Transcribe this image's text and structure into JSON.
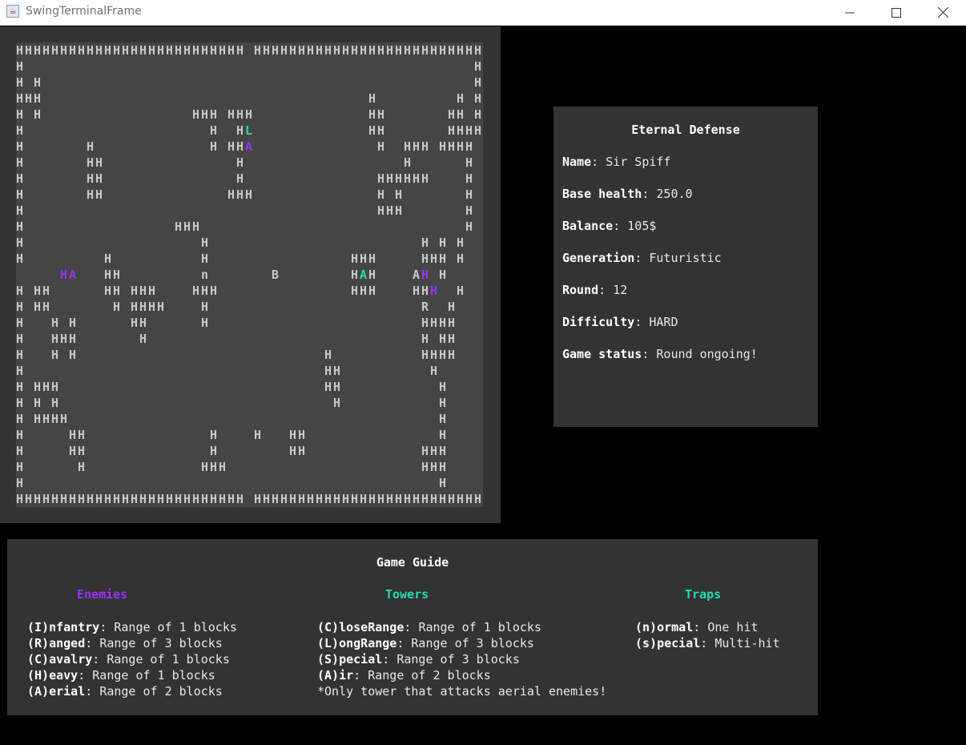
{
  "window": {
    "title": "SwingTerminalFrame"
  },
  "colors": {
    "wall": "#c8c8c8",
    "enemy": "#9b30ff",
    "tower": "#22ddb0",
    "panel": "#333333",
    "grid": "#454545",
    "background": "#000000"
  },
  "map": {
    "rows": [
      "HHHHHHHHHHHHHHHHHHHHHHHHHH HHHHHHHHHHHHHHHHHHHHHHHHHH",
      "H                                                   H",
      "H H                                                 H",
      "HHH                                     H         H H",
      "H H                 HHH HHH             HH       HH H",
      "H                     H  HL             HH       HHHH",
      "H       H             H HHA              H  HHH HHHH",
      "H       HH               H                  H      H",
      "H       HH               H               HHHHHH    H",
      "H       HH              HHH              H H       H",
      "H                                        HHH       H",
      "H                 HHH                              H",
      "H                    H                        H H H",
      "H         H          H                HHH     HHH H",
      "     HA   HH         n       B        HAH    AH H",
      "H HH      HH HHH    HHH               HHH    HHH  H",
      "H HH       H HHHH    H                        R  H",
      "H   H H      HH      H                        HHHH",
      "H   HHH       H                               H HH",
      "H   H H                            H          HHHH",
      "H                                  HH          H",
      "H HHH                              HH           H",
      "H H H                               H           H",
      "H HHHH                                          H",
      "H     HH              H    H   HH               H",
      "H     HH              H        HH             HHH",
      "H      H             HHH                      HHH",
      "H                                               H",
      "HHHHHHHHHHHHHHHHHHHHHHHHHH HHHHHHHHHHHHHHHHHHHHHHHHHH"
    ],
    "colored_cells": [
      {
        "row": 5,
        "col": 26,
        "kind": "tower"
      },
      {
        "row": 6,
        "col": 26,
        "kind": "enemy"
      },
      {
        "row": 14,
        "col": 5,
        "kind": "enemy"
      },
      {
        "row": 14,
        "col": 6,
        "kind": "enemy"
      },
      {
        "row": 14,
        "col": 19,
        "kind": "trap"
      },
      {
        "row": 14,
        "col": 26,
        "kind": "tower"
      },
      {
        "row": 14,
        "col": 39,
        "kind": "tower"
      },
      {
        "row": 14,
        "col": 46,
        "kind": "enemy"
      },
      {
        "row": 15,
        "col": 47,
        "kind": "enemy"
      },
      {
        "row": 16,
        "col": 47,
        "kind": "enemy"
      },
      {
        "row": 24,
        "col": 26,
        "kind": "enemy"
      }
    ]
  },
  "status": {
    "title": "Eternal Defense",
    "fields": [
      {
        "label": "Name",
        "value": "Sir Spiff"
      },
      {
        "label": "Base health",
        "value": "250.0"
      },
      {
        "label": "Balance",
        "value": "105$"
      },
      {
        "label": "Generation",
        "value": "Futuristic"
      },
      {
        "label": "Round",
        "value": "12"
      },
      {
        "label": "Difficulty",
        "value": "HARD"
      },
      {
        "label": "Game status",
        "value": "Round ongoing!"
      }
    ]
  },
  "guide": {
    "title": "Game Guide",
    "enemies": {
      "heading": "Enemies",
      "items": [
        {
          "key": "(I)nfantry",
          "desc": "Range of 1 blocks"
        },
        {
          "key": "(R)anged",
          "desc": "Range of 3 blocks"
        },
        {
          "key": "(C)avalry",
          "desc": "Range of 1 blocks"
        },
        {
          "key": "(H)eavy",
          "desc": "Range of 1 blocks"
        },
        {
          "key": "(A)erial",
          "desc": "Range of 2 blocks"
        }
      ]
    },
    "towers": {
      "heading": "Towers",
      "items": [
        {
          "key": "(C)loseRange",
          "desc": "Range of 1 blocks"
        },
        {
          "key": "(L)ongRange",
          "desc": "Range of 3 blocks"
        },
        {
          "key": "(S)pecial",
          "desc": "Range of 3 blocks"
        },
        {
          "key": "(A)ir",
          "desc": "Range of 2 blocks"
        }
      ],
      "note": "*Only tower that attacks aerial enemies!"
    },
    "traps": {
      "heading": "Traps",
      "items": [
        {
          "key": "(n)ormal",
          "desc": "One hit"
        },
        {
          "key": "(s)pecial",
          "desc": "Multi-hit"
        }
      ]
    }
  }
}
